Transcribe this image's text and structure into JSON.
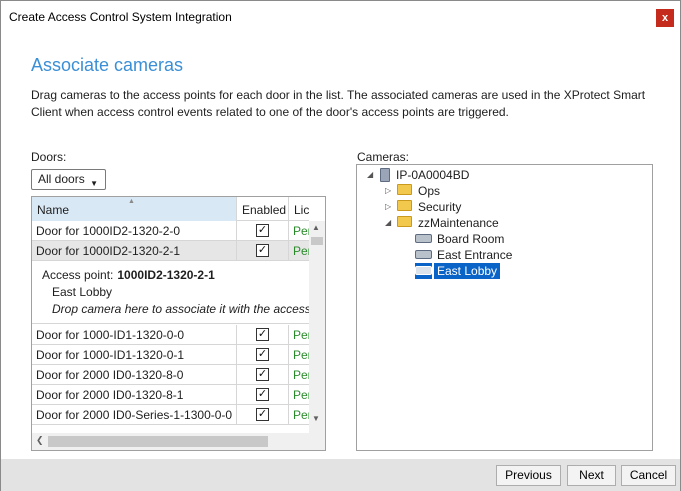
{
  "window": {
    "title": "Create Access Control System Integration",
    "close_glyph": "x"
  },
  "page": {
    "heading": "Associate cameras",
    "description": "Drag cameras to the access points for each door in the list. The associated cameras are used in the XProtect Smart Client when access control events related to one of the door's access points are triggered."
  },
  "doors": {
    "label": "Doors:",
    "filter": {
      "selected": "All doors"
    },
    "columns": {
      "name": "Name",
      "enabled": "Enabled",
      "license": "Lic"
    },
    "rows_top": [
      {
        "name": "Door for 1000ID2-1320-2-0",
        "enabled": true,
        "license": "Per"
      },
      {
        "name": "Door for 1000ID2-1320-2-1",
        "enabled": true,
        "license": "Per",
        "selected": true
      }
    ],
    "detail": {
      "access_point_label": "Access point:",
      "access_point_value": "1000ID2-1320-2-1",
      "camera": "East Lobby",
      "hint": "Drop camera here to associate it with the access p"
    },
    "rows_bottom": [
      {
        "name": "Door for 1000-ID1-1320-0-0",
        "enabled": true,
        "license": "Per"
      },
      {
        "name": "Door for 1000-ID1-1320-0-1",
        "enabled": true,
        "license": "Per"
      },
      {
        "name": "Door for 2000 ID0-1320-8-0",
        "enabled": true,
        "license": "Per"
      },
      {
        "name": "Door for 2000 ID0-1320-8-1",
        "enabled": true,
        "license": "Per"
      },
      {
        "name": "Door for 2000 ID0-Series-1-1300-0-0",
        "enabled": true,
        "license": "Per"
      }
    ]
  },
  "cameras": {
    "label": "Cameras:",
    "tree": {
      "root": "IP-0A0004BD",
      "folders": [
        "Ops",
        "Security",
        "zzMaintenance"
      ],
      "maintenance_cameras": [
        "Board Room",
        "East Entrance",
        "East Lobby"
      ],
      "selected": "East Lobby"
    }
  },
  "buttons": {
    "previous": "Previous",
    "next": "Next",
    "cancel": "Cancel"
  },
  "colors": {
    "heading": "#3a8fd6",
    "selection": "#0a64c8",
    "license_text": "#2a8a2a",
    "close": "#c42b1c"
  }
}
